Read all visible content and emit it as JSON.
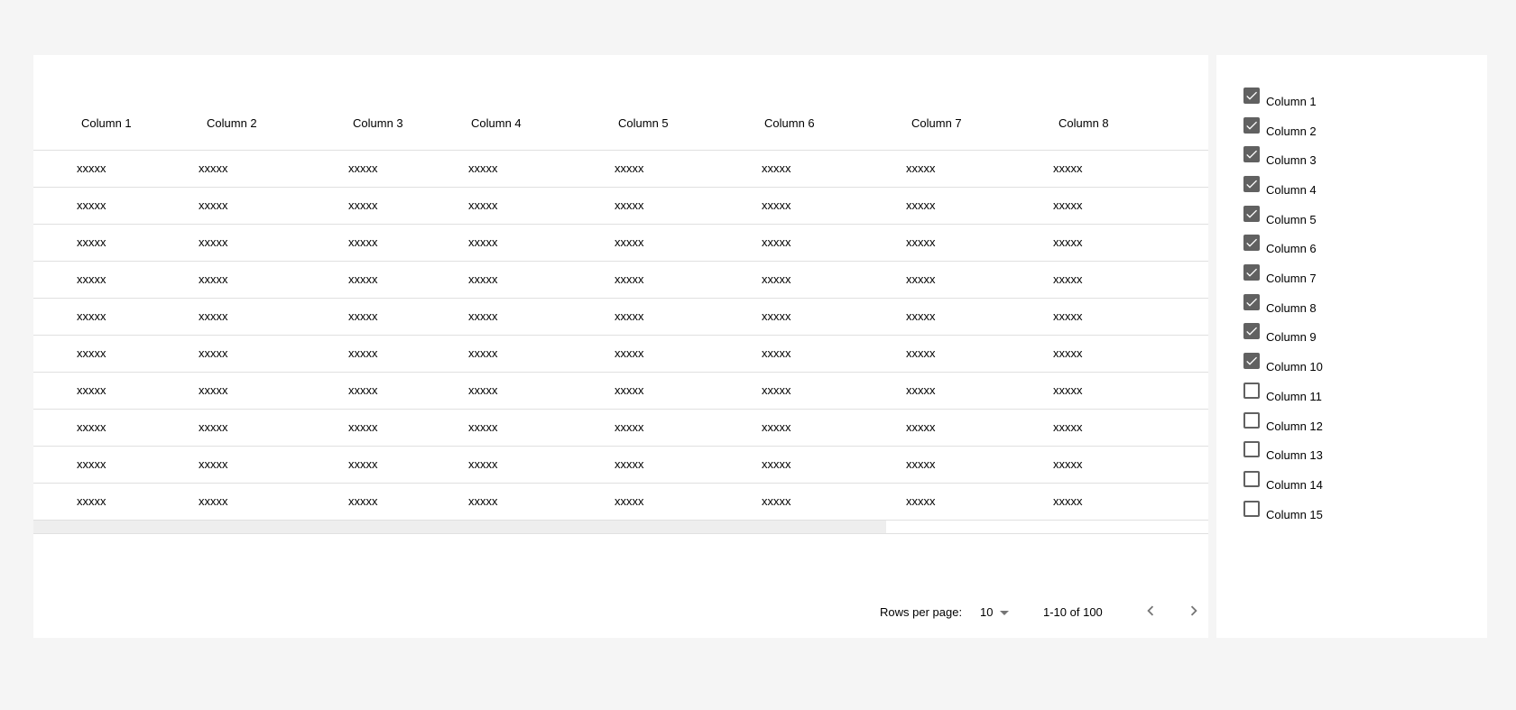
{
  "table": {
    "headers": [
      "Column 1",
      "Column 2",
      "Column 3",
      "Column 4",
      "Column 5",
      "Column 6",
      "Column 7",
      "Column 8"
    ],
    "rows": [
      [
        "xxxxx",
        "xxxxx",
        "xxxxx",
        "xxxxx",
        "xxxxx",
        "xxxxx",
        "xxxxx",
        "xxxxx"
      ],
      [
        "xxxxx",
        "xxxxx",
        "xxxxx",
        "xxxxx",
        "xxxxx",
        "xxxxx",
        "xxxxx",
        "xxxxx"
      ],
      [
        "xxxxx",
        "xxxxx",
        "xxxxx",
        "xxxxx",
        "xxxxx",
        "xxxxx",
        "xxxxx",
        "xxxxx"
      ],
      [
        "xxxxx",
        "xxxxx",
        "xxxxx",
        "xxxxx",
        "xxxxx",
        "xxxxx",
        "xxxxx",
        "xxxxx"
      ],
      [
        "xxxxx",
        "xxxxx",
        "xxxxx",
        "xxxxx",
        "xxxxx",
        "xxxxx",
        "xxxxx",
        "xxxxx"
      ],
      [
        "xxxxx",
        "xxxxx",
        "xxxxx",
        "xxxxx",
        "xxxxx",
        "xxxxx",
        "xxxxx",
        "xxxxx"
      ],
      [
        "xxxxx",
        "xxxxx",
        "xxxxx",
        "xxxxx",
        "xxxxx",
        "xxxxx",
        "xxxxx",
        "xxxxx"
      ],
      [
        "xxxxx",
        "xxxxx",
        "xxxxx",
        "xxxxx",
        "xxxxx",
        "xxxxx",
        "xxxxx",
        "xxxxx"
      ],
      [
        "xxxxx",
        "xxxxx",
        "xxxxx",
        "xxxxx",
        "xxxxx",
        "xxxxx",
        "xxxxx",
        "xxxxx"
      ],
      [
        "xxxxx",
        "xxxxx",
        "xxxxx",
        "xxxxx",
        "xxxxx",
        "xxxxx",
        "xxxxx",
        "xxxxx"
      ]
    ]
  },
  "pagination": {
    "rows_per_page_label": "Rows per page:",
    "rows_per_page_value": "10",
    "range_label": "1-10 of 100",
    "prev_icon": "chevron-left-icon",
    "next_icon": "chevron-right-icon"
  },
  "column_chooser": {
    "options": [
      {
        "label": "Column 1",
        "checked": true
      },
      {
        "label": "Column 2",
        "checked": true
      },
      {
        "label": "Column 3",
        "checked": true
      },
      {
        "label": "Column 4",
        "checked": true
      },
      {
        "label": "Column 5",
        "checked": true
      },
      {
        "label": "Column 6",
        "checked": true
      },
      {
        "label": "Column 7",
        "checked": true
      },
      {
        "label": "Column 8",
        "checked": true
      },
      {
        "label": "Column 9",
        "checked": true
      },
      {
        "label": "Column 10",
        "checked": true
      },
      {
        "label": "Column 11",
        "checked": false
      },
      {
        "label": "Column 12",
        "checked": false
      },
      {
        "label": "Column 13",
        "checked": false
      },
      {
        "label": "Column 14",
        "checked": false
      },
      {
        "label": "Column 15",
        "checked": false
      }
    ]
  },
  "colors": {
    "page_background": "#f5f5f5",
    "card_background": "#ffffff",
    "divider": "#e0e0e0",
    "checkbox": "#616161",
    "icon": "#757575"
  }
}
